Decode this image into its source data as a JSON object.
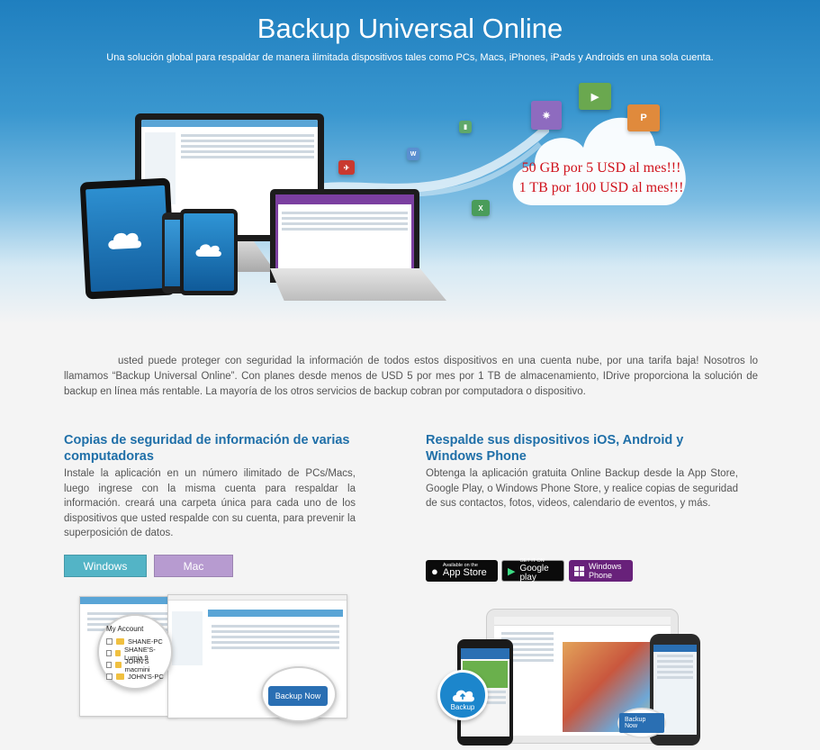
{
  "hero": {
    "title": "Backup Universal Online",
    "subtitle": "Una solución global para respaldar de manera ilimitada dispositivos tales como PCs, Macs, iPhones, iPads y Androids en una sola cuenta.",
    "price_line_1": "50 GB por 5 USD al mes!!!",
    "price_line_2": "1 TB por 100 USD al mes!!!"
  },
  "intro": {
    "text": "usted puede proteger con seguridad la información de todos estos dispositivos en una cuenta nube, por una tarifa baja! Nosotros lo llamamos “Backup Universal Online”. Con planes desde menos de USD 5 por mes por 1 TB de almacenamiento, IDrive proporciona la solución de backup en línea más rentable. La mayoría de los otros servicios de backup cobran por computadora o dispositivo."
  },
  "left_section": {
    "title": "Copias de seguridad de información de varias computadoras",
    "text": "Instale la aplicación          en un número ilimitado de PCs/Macs, luego ingrese con la misma cuenta             para respaldar la información.          creará una carpeta única para cada uno de los dispositivos que usted respalde con su cuenta, para prevenir la superposición de datos.",
    "btn_windows": "Windows",
    "btn_mac": "Mac",
    "account_title": "My Account",
    "accounts": [
      "SHANE-PC",
      "SHANE'S-Lumia 9",
      "JOHN'S macmini",
      "JOHN'S-PC"
    ],
    "backup_now": "Backup Now"
  },
  "right_section": {
    "title": "Respalde sus dispositivos iOS, Android y Windows Phone",
    "text": "Obtenga la aplicación gratuita          Online Backup desde la App Store, Google Play, o Windows Phone Store, y realice copias de seguridad de sus contactos, fotos, videos, calendario de eventos, y más.",
    "appstore_small": "Available on the",
    "appstore_big": "App Store",
    "gplay_small": "GET IT ON",
    "gplay_big": "Google play",
    "wp_line1": "Windows",
    "wp_line2": "Phone",
    "backup_label": "Backup",
    "backup_now": "Backup Now"
  },
  "colors": {
    "hero_blue": "#1f7fbf",
    "price_red": "#d0111b",
    "heading_blue": "#1f6fa8",
    "windows_btn": "#53b4c6",
    "mac_btn": "#b79bd0",
    "wp_purple": "#68217a"
  }
}
